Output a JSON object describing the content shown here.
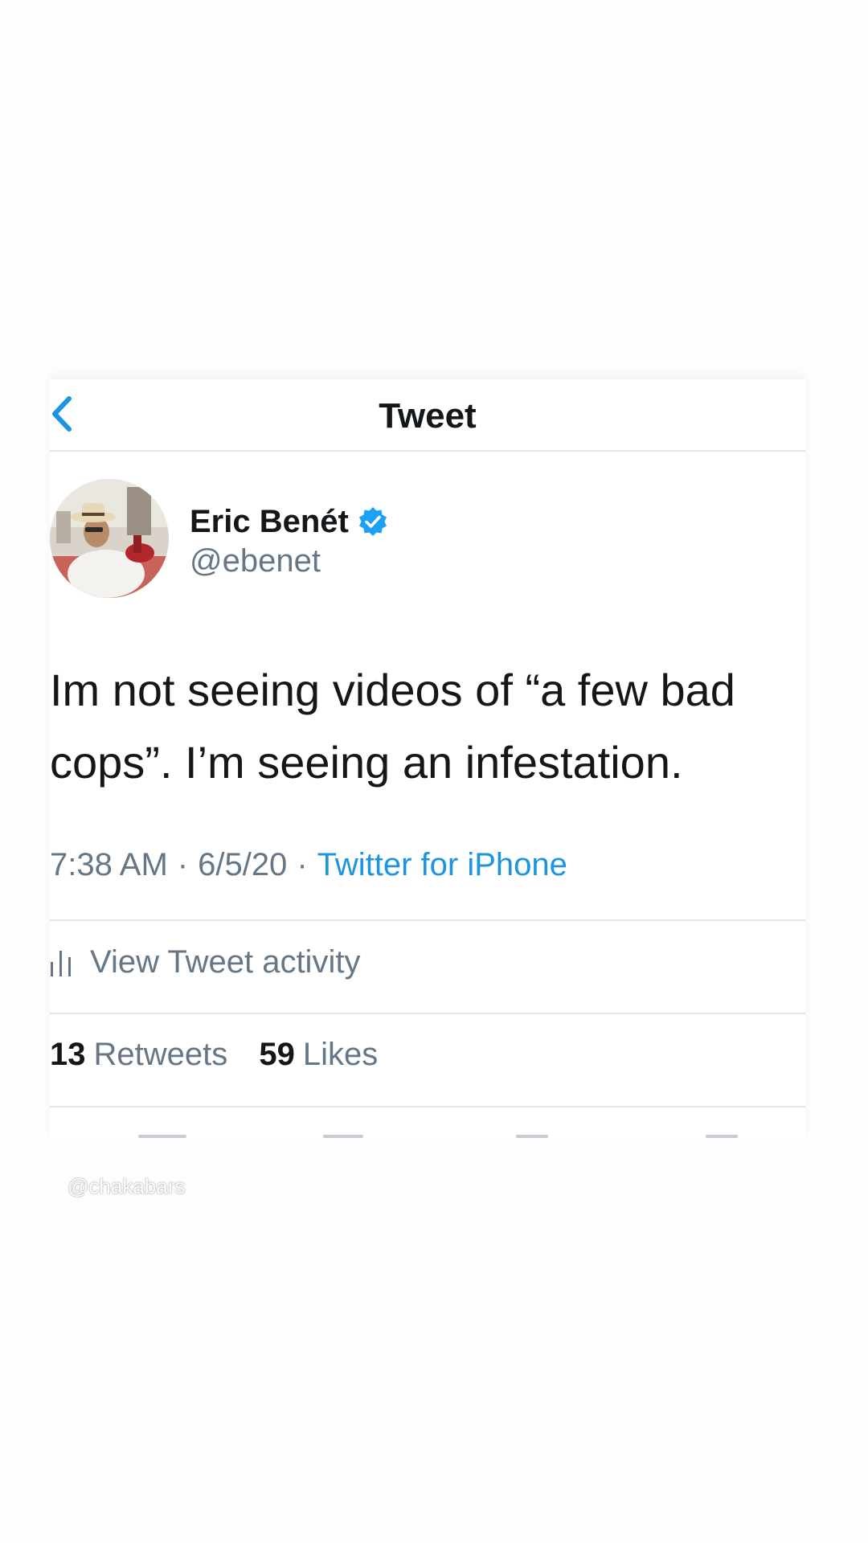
{
  "nav": {
    "title": "Tweet"
  },
  "tweet": {
    "author": {
      "display_name": "Eric Benét",
      "handle": "@ebenet",
      "verified": true
    },
    "text": "Im not seeing videos of “a few bad cops”. I’m seeing an infestation.",
    "time": "7:38 AM",
    "date": "6/5/20",
    "source": "Twitter for iPhone",
    "meta_separator": "·",
    "activity_label": "View Tweet activity",
    "retweets_count": "13",
    "retweets_label": "Retweets",
    "likes_count": "59",
    "likes_label": "Likes"
  },
  "watermark": "@chakabars",
  "colors": {
    "accent": "#1b95e0",
    "verified": "#1da1f2",
    "secondary_text": "#657786",
    "primary_text": "#14171a",
    "divider": "#e1e6ea"
  },
  "icons": {
    "back": "chevron-left-icon",
    "verified": "verified-badge-icon",
    "activity": "bar-chart-icon"
  }
}
